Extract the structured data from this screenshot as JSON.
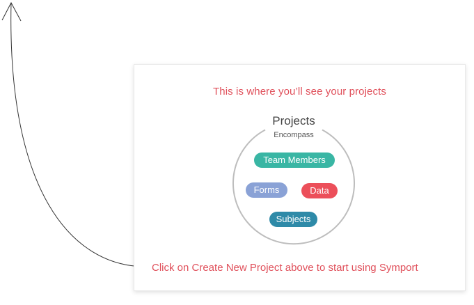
{
  "empty_state": {
    "headline": "This is where you’ll see your projects",
    "cta": "Click on Create New Project above to start using Symport"
  },
  "diagram": {
    "title": "Projects",
    "subtitle": "Encompass",
    "items": [
      {
        "label": "Team Members",
        "color": "#39b6a4"
      },
      {
        "label": "Forms",
        "color": "#8aa2d6"
      },
      {
        "label": "Data",
        "color": "#ec4f5a"
      },
      {
        "label": "Subjects",
        "color": "#2e8aa8"
      }
    ]
  },
  "colors": {
    "accent_text": "#e0505b",
    "circle": "#bdbdbd",
    "arrow": "#333333"
  }
}
